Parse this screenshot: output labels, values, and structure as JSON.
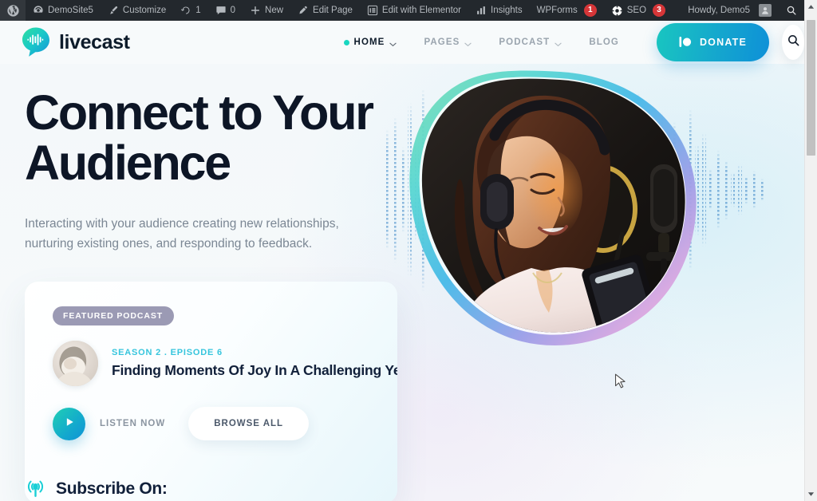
{
  "adminbar": {
    "wp_logo": "wordpress-logo",
    "items": [
      {
        "label": "DemoSite5",
        "icon": "dashboard-icon",
        "name": "site-name"
      },
      {
        "label": "Customize",
        "icon": "paintbrush-icon",
        "name": "customize"
      },
      {
        "label": "1",
        "icon": "updates-icon",
        "name": "updates"
      },
      {
        "label": "0",
        "icon": "comment-icon",
        "name": "comments"
      },
      {
        "label": "New",
        "icon": "plus-icon",
        "name": "new-content"
      },
      {
        "label": "Edit Page",
        "icon": "pencil-icon",
        "name": "edit-page"
      },
      {
        "label": "Edit with Elementor",
        "icon": "elementor-icon",
        "name": "edit-with-elementor"
      },
      {
        "label": "Insights",
        "icon": "bar-chart-icon",
        "name": "insights"
      },
      {
        "label": "WPForms",
        "icon": "none",
        "name": "wpforms",
        "badge": "1"
      },
      {
        "label": "SEO",
        "icon": "aioseo-icon",
        "name": "seo",
        "badge": "3"
      }
    ],
    "howdy": "Howdy, Demo5",
    "avatar": "user-avatar",
    "search": "search-icon",
    "badge_color": "#d63638"
  },
  "header": {
    "brand": "livecast",
    "logo_icon": "livecast-speech-bubble-logo",
    "nav": [
      {
        "label": "HOME",
        "active": true,
        "caret": true
      },
      {
        "label": "PAGES",
        "active": false,
        "caret": true
      },
      {
        "label": "PODCAST",
        "active": false,
        "caret": true
      },
      {
        "label": "BLOG",
        "active": false,
        "caret": false
      }
    ],
    "donate_label": "DONATE",
    "donate_icon": "donate-coin-icon",
    "search_icon": "search-icon",
    "accent_teal": "#18d6c0",
    "accent_blue": "#0e90d8"
  },
  "hero": {
    "title": "Connect to Your Audience",
    "subtitle": "Interacting with your audience creating new relationships, nurturing existing ones, and responding to feedback.",
    "image_alt": "woman-with-headphones-recording-podcast",
    "waveform_decoration": "dotted-audio-waveform"
  },
  "featured_card": {
    "badge": "FEATURED PODCAST",
    "badge_color": "#9b9ab4",
    "meta": "SEASON 2 . EPISODE 6",
    "meta_color": "#36c5dd",
    "title": "Finding Moments Of Joy In A Challenging Year",
    "thumbnail_alt": "episode-thumbnail",
    "play_icon": "play-icon",
    "listen_label": "LISTEN NOW",
    "browse_label": "BROWSE ALL"
  },
  "subscribe": {
    "icon": "podcast-broadcast-icon",
    "label": "Subscribe On:"
  },
  "browser": {
    "scrollbar_up": "scroll-up-arrow",
    "scrollbar_down": "scroll-down-arrow"
  }
}
